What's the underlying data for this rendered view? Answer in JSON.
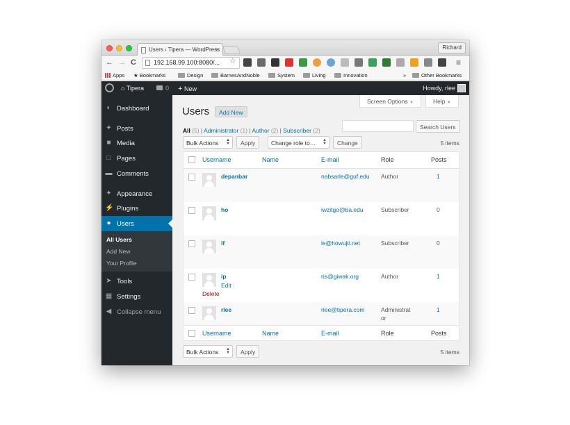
{
  "browser": {
    "tab_title": "Users ‹ Tipera — WordPress",
    "tab_close": "×",
    "profile_name": "Richard",
    "url": "192.168.99.100:8080/...",
    "nav": {
      "back": "←",
      "forward": "→",
      "reload": "C",
      "star": "☆",
      "menu": "≡"
    },
    "bookmarks": {
      "apps": "Apps",
      "bookmarks": "Bookmarks",
      "folders": [
        "Design",
        "BarnesAndNoble",
        "System",
        "Living",
        "Innovation"
      ],
      "overflow": "»",
      "other": "Other Bookmarks"
    }
  },
  "adminbar": {
    "site_name": "Tipera",
    "comments_count": "0",
    "new_label": "New",
    "new_plus": "+",
    "howdy": "Howdy, rlee"
  },
  "sidebar": {
    "items": [
      {
        "label": "Dashboard",
        "icon": "dashboard-icon"
      },
      {
        "label": "Posts",
        "icon": "pin-icon"
      },
      {
        "label": "Media",
        "icon": "media-icon"
      },
      {
        "label": "Pages",
        "icon": "pages-icon"
      },
      {
        "label": "Comments",
        "icon": "comment-icon"
      },
      {
        "label": "Appearance",
        "icon": "brush-icon"
      },
      {
        "label": "Plugins",
        "icon": "plug-icon"
      },
      {
        "label": "Users",
        "icon": "user-icon"
      },
      {
        "label": "Tools",
        "icon": "wrench-icon"
      },
      {
        "label": "Settings",
        "icon": "settings-icon"
      }
    ],
    "submenu": [
      "All Users",
      "Add New",
      "Your Profile"
    ],
    "collapse": "Collapse menu"
  },
  "screen_options": {
    "label": "Screen Options",
    "help": "Help",
    "arrow": "▼"
  },
  "page": {
    "title": "Users",
    "add_new": "Add New",
    "filters": {
      "all": "All",
      "all_count": "(5)",
      "administrator": "Administrator",
      "administrator_count": "(1)",
      "author": "Author",
      "author_count": "(2)",
      "subscriber": "Subscriber",
      "subscriber_count": "(2)",
      "sep": "|"
    },
    "search_button": "Search Users",
    "search_value": "",
    "bulk_actions": "Bulk Actions",
    "apply": "Apply",
    "change_role": "Change role to…",
    "change": "Change",
    "items_count": "5 items"
  },
  "table": {
    "columns": [
      "Username",
      "Name",
      "E-mail",
      "Role",
      "Posts"
    ],
    "rows": [
      {
        "username": "depanbar",
        "name": "",
        "email": "nabsarle@guf.edu",
        "role": "Author",
        "posts": "1"
      },
      {
        "username": "ho",
        "name": "",
        "email": "iwzitgo@ba.edu",
        "role": "Subscriber",
        "posts": "0"
      },
      {
        "username": "if",
        "name": "",
        "email": "le@howujti.net",
        "role": "Subscriber",
        "posts": "0"
      },
      {
        "username": "ip",
        "name": "",
        "email": "ris@giwak.org",
        "role": "Author",
        "posts": "1"
      },
      {
        "username": "rlee",
        "name": "",
        "email": "rlee@tipera.com",
        "role_line1": "Administrat",
        "role_line2": "or",
        "posts": "1"
      }
    ],
    "row_actions": {
      "edit": "Edit",
      "sep": "|",
      "delete": "Delete"
    }
  }
}
